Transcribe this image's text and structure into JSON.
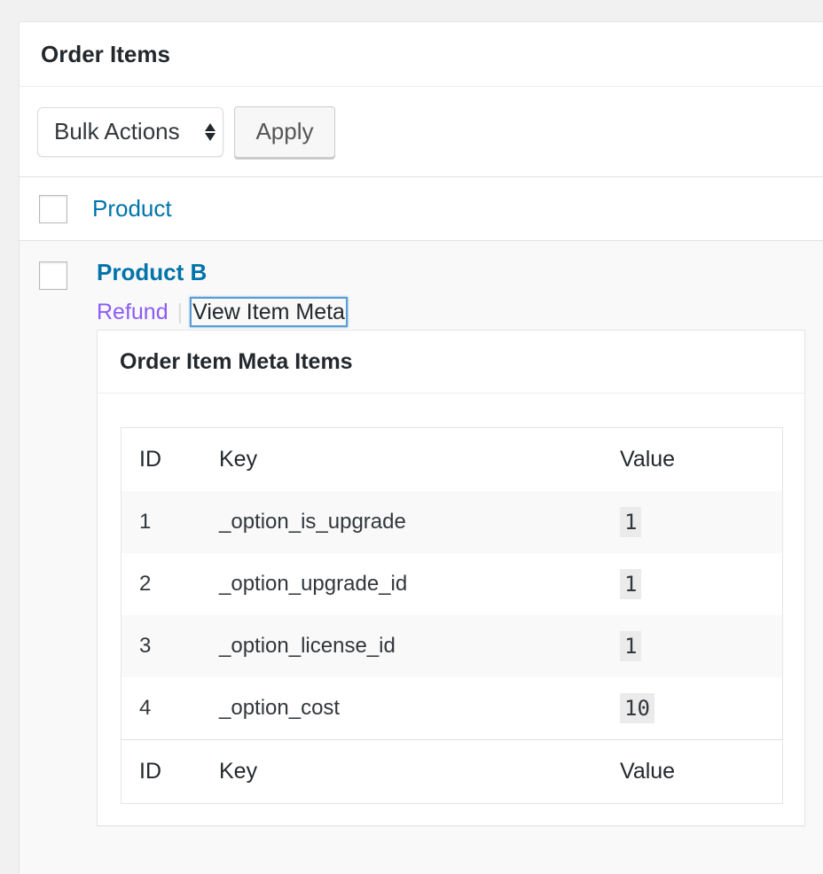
{
  "panel": {
    "title": "Order Items"
  },
  "tablenav": {
    "bulk_actions_label": "Bulk Actions",
    "apply_label": "Apply"
  },
  "table": {
    "column_product": "Product"
  },
  "item": {
    "name": "Product B",
    "actions": {
      "refund": "Refund",
      "view_meta": "View Item Meta"
    }
  },
  "meta": {
    "title": "Order Item Meta Items",
    "columns": {
      "id": "ID",
      "key": "Key",
      "value": "Value"
    },
    "rows": [
      {
        "id": "1",
        "key": "_option_is_upgrade",
        "value": "1"
      },
      {
        "id": "2",
        "key": "_option_upgrade_id",
        "value": "1"
      },
      {
        "id": "3",
        "key": "_option_license_id",
        "value": "1"
      },
      {
        "id": "4",
        "key": "_option_cost",
        "value": "10"
      }
    ]
  }
}
